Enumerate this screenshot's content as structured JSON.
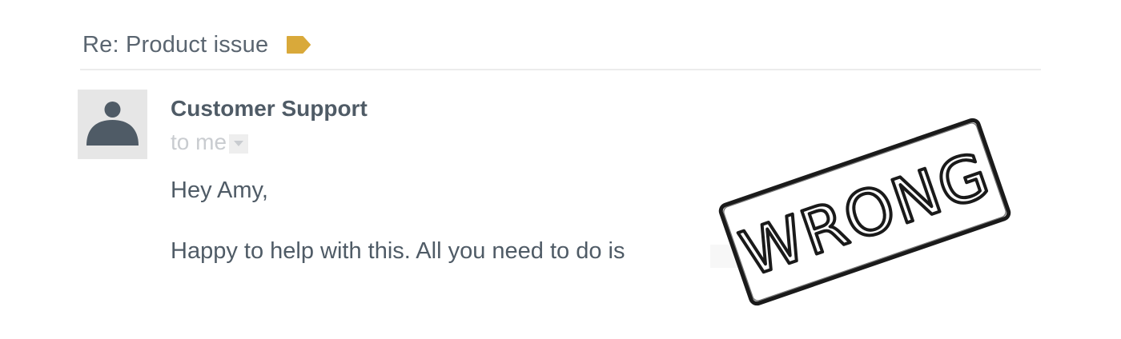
{
  "email": {
    "subject": "Re: Product issue",
    "label_icon": "label-tag-icon",
    "label_color": "#D9A93A",
    "sender": "Customer Support",
    "recipient": "to me",
    "greeting": "Hey Amy,",
    "body_line": "Happy to help with this. All you need to do is"
  },
  "stamp": {
    "text": "WRONG"
  }
}
